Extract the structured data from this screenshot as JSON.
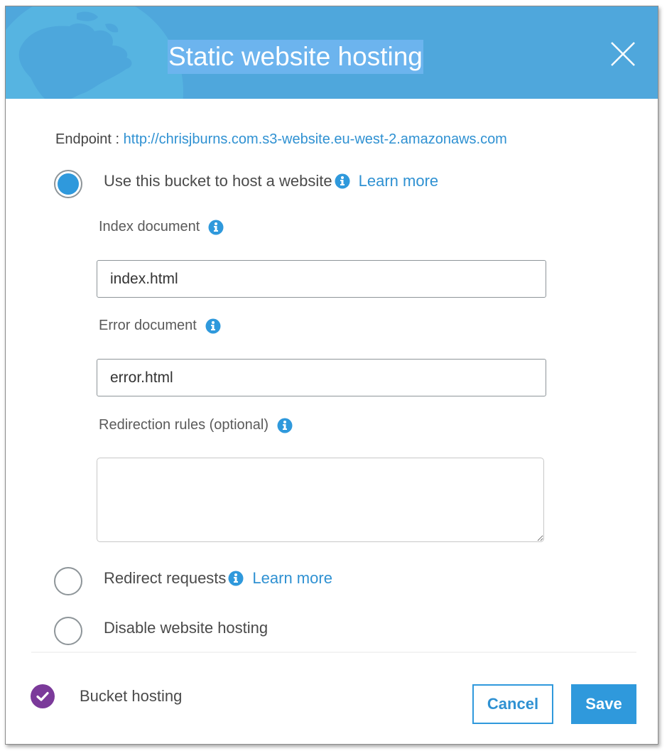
{
  "dialog": {
    "title": "Static website hosting",
    "close_icon": "close-icon",
    "endpoint": {
      "label": "Endpoint :",
      "url": "http://chrisjburns.com.s3-website.eu-west-2.amazonaws.com"
    },
    "options": [
      {
        "label": "Use this bucket to host a website",
        "selected": true,
        "has_info": true,
        "learn_more": "Learn more"
      },
      {
        "label": "Redirect requests",
        "selected": false,
        "has_info": true,
        "learn_more": "Learn more"
      },
      {
        "label": "Disable website hosting",
        "selected": false,
        "has_info": false
      }
    ],
    "fields": {
      "index_document": {
        "label": "Index document",
        "value": "index.html",
        "placeholder": ""
      },
      "error_document": {
        "label": "Error document",
        "value": "error.html",
        "placeholder": ""
      },
      "redirection_rules": {
        "label": "Redirection rules (optional)",
        "value": ""
      }
    },
    "footer": {
      "status_label": "Bucket hosting",
      "status_icon": "check-circle-icon",
      "cancel_label": "Cancel",
      "save_label": "Save"
    }
  },
  "colors": {
    "header_bg": "#4fa7dc",
    "accent": "#2f99dc",
    "link": "#2f91d2",
    "status_purple": "#7b3a9a"
  }
}
